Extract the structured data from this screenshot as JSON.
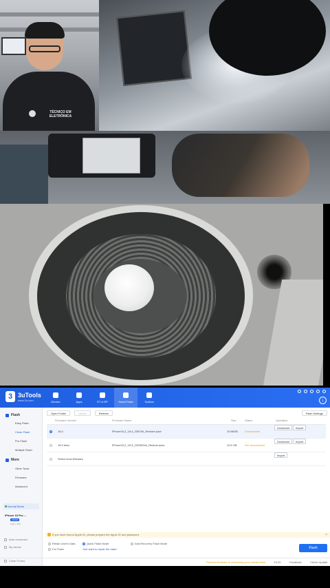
{
  "app": {
    "brand_name": "3uTools",
    "brand_version": "www.3u.com",
    "nav": [
      {
        "label": "iDevice"
      },
      {
        "label": "Apps"
      },
      {
        "label": "RT & RP"
      },
      {
        "label": "Smart Flash"
      },
      {
        "label": "Toolbox"
      }
    ],
    "active_nav": "Smart Flash"
  },
  "sidebar": {
    "flash_group": "Flash",
    "flash_items": [
      "Easy Flash",
      "Clean Flash",
      "Pro Flash",
      "Multiple Flash"
    ],
    "more_group": "More",
    "more_items": [
      "Other Tools",
      "Firmware",
      "Advanced"
    ],
    "device_mode": "Normal Mode",
    "device_name": "iPhone 15 Pro ...",
    "device_badge": "256GB",
    "device_sub": "Gold + 256",
    "bottom_items": [
      "Auto reconnect",
      "My device",
      "Close iTunes"
    ]
  },
  "toolbar": {
    "open_folder": "Open Folder",
    "delete": "Delete",
    "refresh": "Refresh",
    "flash_settings": "Flash Settings"
  },
  "table": {
    "headers": [
      "Firmware Version",
      "Firmware Name",
      "Size",
      "Status",
      "Operation"
    ],
    "rows": [
      {
        "version": "18.4",
        "name": "iPhone16,2_18.4_22E240_Restore.ipsw",
        "size": "10.86GB",
        "status": "Downloaded",
        "op1": "Download",
        "op2": "Import",
        "selected": true
      },
      {
        "version": "18.3 beta",
        "name": "iPhone16,2_18.3_22D5034e_Restore.ipsw",
        "size": "10.5 GB",
        "status": "Not downloaded",
        "op1": "Download",
        "op2": "Import",
        "selected": false
      },
      {
        "version": "Select local firmware",
        "name": "",
        "size": "",
        "status": "",
        "op1": "Import",
        "op2": "",
        "selected": false
      }
    ]
  },
  "warning": "If you have bound Apple ID, please prepare the Apple ID and password.",
  "options": {
    "retain_data": "Retain User's Data",
    "quick_flash": "Quick Flash Mode",
    "anti_recovery": "Anti-Recovery Flash Mode",
    "for_flash": "For Flash",
    "repair_link": "Just want to repair the data?"
  },
  "flash_button": "Flash",
  "footer": {
    "preview": "Preview firmware is converting your cellular data",
    "version": "V3.20",
    "feedback": "Feedback",
    "check_update": "Check Update"
  },
  "shirt_text": "TÉCNICO EM ELETRÔNICA",
  "colors": {
    "header_blue": "#2a6ef2",
    "status_orange": "#e8a317",
    "flash_button": "#1f6ff2"
  }
}
